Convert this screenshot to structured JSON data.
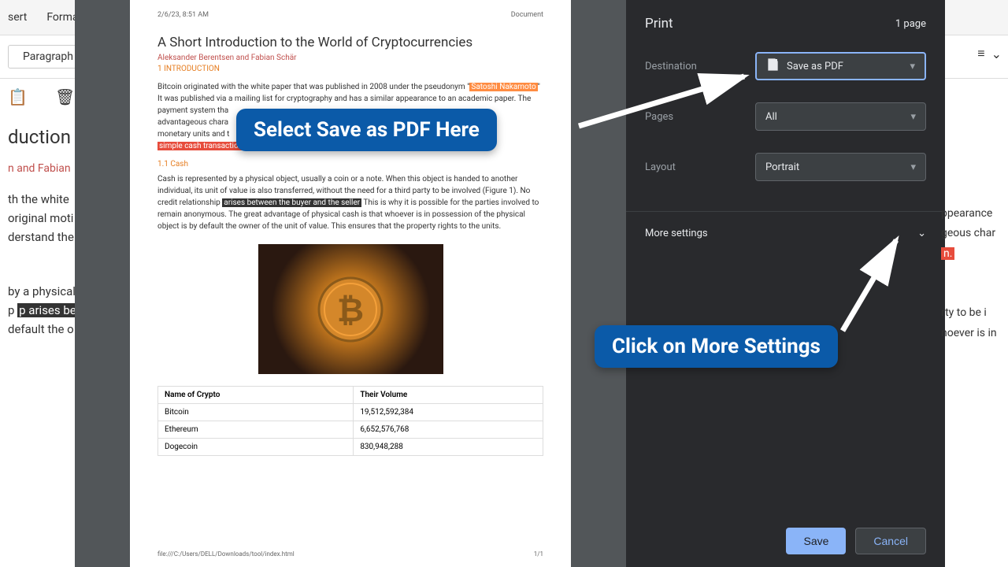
{
  "editor": {
    "menu": [
      "sert",
      "Format"
    ],
    "style": "Paragraph",
    "title_frag": "duction t",
    "auth_frag": "n and Fabian",
    "para1_lines": [
      "th the white",
      "original moti",
      "derstand the"
    ],
    "para2_lines": [
      "by a physical",
      "p arises betw",
      "default the o"
    ]
  },
  "doc": {
    "timestamp": "2/6/23, 8:51 AM",
    "header_label": "Document",
    "title": "A Short Introduction to the World of Cryptocurrencies",
    "authors": "Aleksander Berentsen and Fabian Schär",
    "section1": "1 INTRODUCTION",
    "subsection": "1.1 Cash",
    "p1_a": "Bitcoin originated with the white paper that was published in 2008 under the pseudonym \"",
    "p1_hl1": "Satoshi Nakamoto",
    "p1_b": "\" It was published via a mailing list for cryptography and has a similar appearance to an academic paper. The",
    "p1_c": "payment system tha",
    "p1_d": "advantageous chara",
    "p1_e": "monetary units and t",
    "p1_hl2": "simple cash transaction",
    "p2_a": "Cash is represented by a physical object, usually a coin or a note. When this object is handed to another individual, its unit of value is also transferred, without the need for a third party to be involved (Figure 1). No credit relationship ",
    "p2_hl": "arises between the buyer and the seller",
    "p2_b": " This is why it is possible for the parties involved to remain anonymous. The great advantage of physical cash is that whoever is in possession of the physical object is by default the owner of the unit of value. This ensures that the property rights to the units.",
    "table": {
      "headers": [
        "Name of Crypto",
        "Their Volume"
      ],
      "rows": [
        [
          "Bitcoin",
          "19,512,592,384"
        ],
        [
          "Ethereum",
          "6,652,576,768"
        ],
        [
          "Dogecoin",
          "830,948,288"
        ]
      ]
    },
    "footer_path": "file:///C:/Users/DELL/Downloads/tool/index.html",
    "footer_page": "1/1"
  },
  "print": {
    "title": "Print",
    "page_count": "1 page",
    "destination_label": "Destination",
    "destination_value": "Save as PDF",
    "pages_label": "Pages",
    "pages_value": "All",
    "layout_label": "Layout",
    "layout_value": "Portrait",
    "more_settings": "More settings",
    "save": "Save",
    "cancel": "Cancel"
  },
  "callouts": {
    "c1": "Select Save as PDF Here",
    "c2": "Click on More Settings"
  },
  "right_bg": {
    "lines": [
      "ppearance",
      "geous char",
      "n.",
      "",
      "rty to be i",
      "noever is in"
    ]
  }
}
